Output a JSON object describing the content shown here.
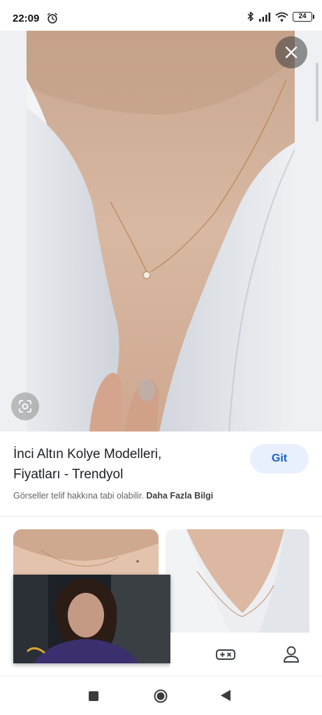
{
  "status_bar": {
    "time": "22:09",
    "battery_level": "24",
    "icons": [
      "alarm-icon",
      "bluetooth-icon",
      "signal-icon",
      "wifi-icon",
      "battery-icon"
    ]
  },
  "viewer": {
    "close_icon": "close-icon",
    "lens_icon": "lens-icon"
  },
  "result": {
    "title_line1": "İnci Altın Kolye Modelleri,",
    "title_line2": "Fiyatları - Trendyol",
    "visit_label": "Git",
    "copyright_text": "Görseller telif hakkına tabi olabilir.",
    "more_info_label": "Daha Fazla Bilgi"
  },
  "related": {
    "items": [
      "related-image-1",
      "related-image-2"
    ]
  },
  "bottom_bar": {
    "icons": [
      "games-icon",
      "account-icon"
    ]
  },
  "system_nav": {
    "icons": [
      "recents-icon",
      "home-icon",
      "back-icon"
    ]
  },
  "colors": {
    "accent": "#1a5fcc",
    "visit_button_bg": "#e8f0fe",
    "text_primary": "#202124",
    "text_secondary": "#5f6368"
  }
}
